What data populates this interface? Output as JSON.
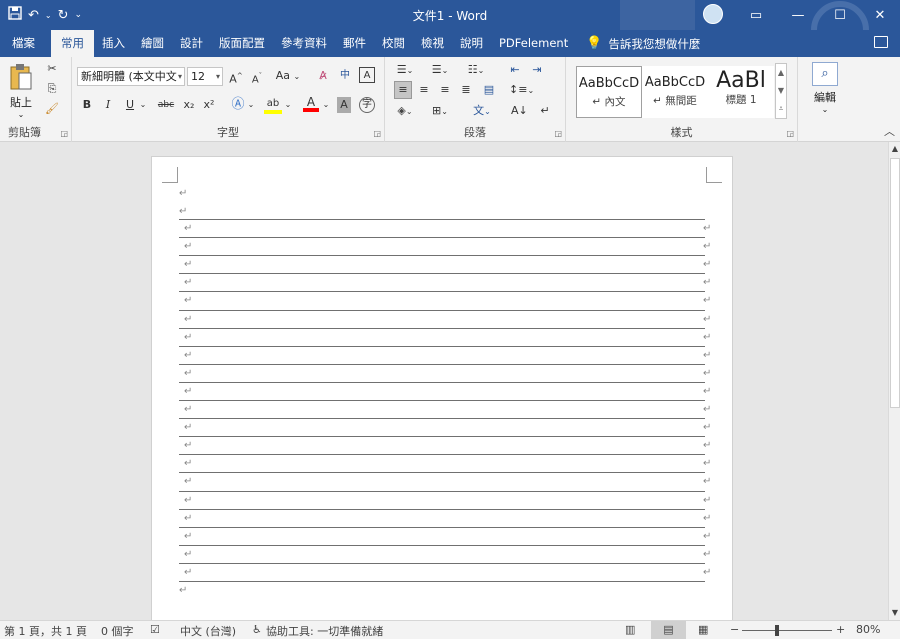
{
  "window": {
    "title": "文件1 - Word",
    "controls": {
      "ribbon_display": "ribbon-display-icon",
      "minimize": "minimize-icon",
      "maximize": "maximize-icon",
      "close": "close-icon"
    }
  },
  "quick_access": [
    "save-icon",
    "undo-icon",
    "redo-icon",
    "customize-qat-icon"
  ],
  "tabs": [
    "檔案",
    "常用",
    "插入",
    "繪圖",
    "設計",
    "版面配置",
    "參考資料",
    "郵件",
    "校閱",
    "檢視",
    "說明",
    "PDFelement"
  ],
  "active_tab": "常用",
  "tell_me": "告訴我您想做什麼",
  "ribbon": {
    "clipboard": {
      "label": "剪貼簿",
      "paste": "貼上"
    },
    "font": {
      "label": "字型",
      "font_name": "新細明體 (本文中文",
      "font_size": "12",
      "aa_label": "Aa",
      "bold": "B",
      "italic": "I",
      "underline": "U",
      "strike": "abc",
      "sub": "x₂",
      "sup": "x²",
      "effects": "A",
      "highlight": "ab",
      "font_color": "A",
      "shade": "A",
      "circle": "字"
    },
    "paragraph": {
      "label": "段落"
    },
    "styles": {
      "label": "樣式",
      "items": [
        {
          "preview": "AaBbCcD",
          "name": "↵ 內文"
        },
        {
          "preview": "AaBbCcD",
          "name": "↵ 無間距"
        },
        {
          "preview": "AaBl",
          "name": "標題 1"
        }
      ]
    },
    "editing": {
      "label": "編輯"
    }
  },
  "document": {
    "para_mark": "↵",
    "ruled_line_count": 20
  },
  "status": {
    "page": "第 1 頁，共 1 頁",
    "words": "0 個字",
    "language": "中文 (台灣)",
    "accessibility": "協助工具: 一切準備就緒",
    "zoom": "80%",
    "zoom_minus": "−",
    "zoom_plus": "+"
  },
  "colors": {
    "brand": "#2b579a",
    "ribbon_bg": "#f3f3f3",
    "highlight": "#ffff00",
    "font_color": "#ff0000"
  }
}
